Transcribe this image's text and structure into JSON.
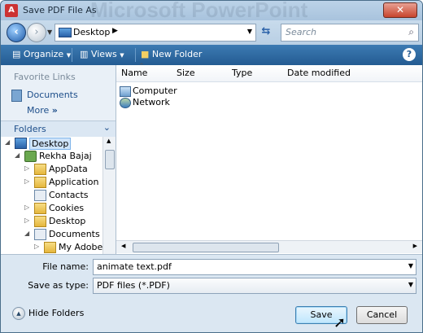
{
  "window": {
    "title": "Save PDF File As",
    "background_app_title": "Microsoft PowerPoint",
    "close_label": "✕"
  },
  "address_bar": {
    "location": "Desktop",
    "search_placeholder": "Search"
  },
  "toolbar": {
    "organize": "Organize",
    "views": "Views",
    "new_folder": "New Folder"
  },
  "left_pane": {
    "favorite_links_heading": "Favorite Links",
    "favorite_links": [
      {
        "label": "Documents"
      }
    ],
    "more_label": "More",
    "folders_heading": "Folders",
    "tree": [
      {
        "label": "Desktop",
        "level": 0,
        "expanded": true,
        "selected": true,
        "icon": "desktop-icon"
      },
      {
        "label": "Rekha Bajaj",
        "level": 1,
        "expanded": true,
        "icon": "user-icon"
      },
      {
        "label": "AppData",
        "level": 2,
        "icon": "folder-icon"
      },
      {
        "label": "Application Da",
        "level": 2,
        "icon": "folder-icon"
      },
      {
        "label": "Contacts",
        "level": 2,
        "icon": "contacts-icon"
      },
      {
        "label": "Cookies",
        "level": 2,
        "icon": "folder-icon"
      },
      {
        "label": "Desktop",
        "level": 2,
        "icon": "folder-icon"
      },
      {
        "label": "Documents",
        "level": 2,
        "expanded": true,
        "icon": "documents-icon"
      },
      {
        "label": "My Adobe C",
        "level": 3,
        "icon": "folder-icon"
      }
    ]
  },
  "file_list": {
    "columns": [
      "Name",
      "Size",
      "Type",
      "Date modified"
    ],
    "items": [
      {
        "name": "Computer",
        "icon": "computer-icon"
      },
      {
        "name": "Network",
        "icon": "network-icon"
      }
    ]
  },
  "form": {
    "file_name_label": "File name:",
    "file_name_value": "animate text.pdf",
    "save_as_type_label": "Save as type:",
    "save_as_type_value": "PDF files (*.PDF)"
  },
  "footer": {
    "hide_folders": "Hide Folders",
    "save": "Save",
    "cancel": "Cancel"
  },
  "colors": {
    "toolbar": "#245b92",
    "link": "#1d4e8a",
    "primary_button_border": "#3c7fb1"
  }
}
